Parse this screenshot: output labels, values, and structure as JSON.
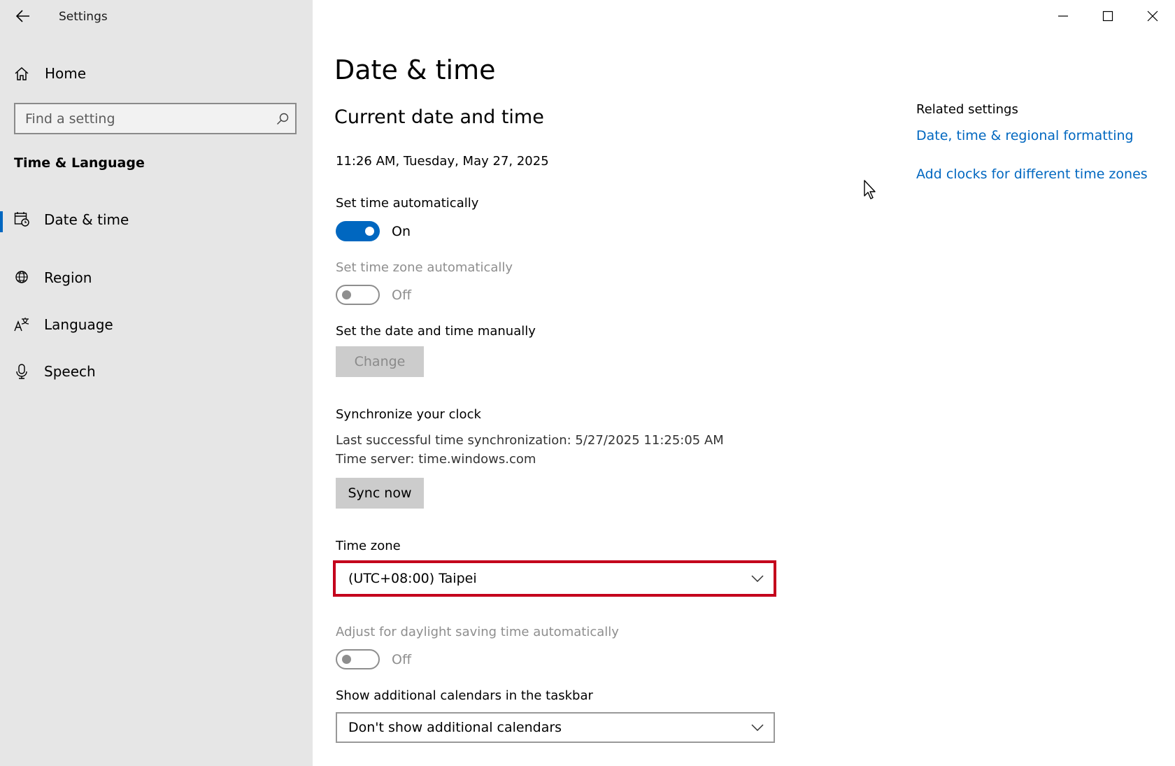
{
  "window": {
    "title": "Settings",
    "controls": [
      "minimize-icon",
      "maximize-icon",
      "close-icon"
    ]
  },
  "sidebar": {
    "home_label": "Home",
    "search_placeholder": "Find a setting",
    "section_title": "Time & Language",
    "items": [
      {
        "label": "Date & time",
        "icon": "calendar-clock-icon",
        "active": true
      },
      {
        "label": "Region",
        "icon": "globe-icon",
        "active": false
      },
      {
        "label": "Language",
        "icon": "language-icon",
        "active": false
      },
      {
        "label": "Speech",
        "icon": "microphone-icon",
        "active": false
      }
    ]
  },
  "main": {
    "title": "Date & time",
    "subtitle": "Current date and time",
    "current_datetime": "11:26 AM, Tuesday, May 27, 2025",
    "set_time_auto": {
      "label": "Set time automatically",
      "state": "On",
      "on": true
    },
    "set_tz_auto": {
      "label": "Set time zone automatically",
      "state": "Off",
      "on": false,
      "disabled": true
    },
    "manual": {
      "label": "Set the date and time manually",
      "button": "Change"
    },
    "sync": {
      "title": "Synchronize your clock",
      "last_sync": "Last successful time synchronization: 5/27/2025 11:25:05 AM",
      "server": "Time server: time.windows.com",
      "button": "Sync now"
    },
    "timezone": {
      "label": "Time zone",
      "value": "(UTC+08:00) Taipei"
    },
    "dst": {
      "label": "Adjust for daylight saving time automatically",
      "state": "Off",
      "on": false,
      "disabled": true
    },
    "calendars": {
      "label": "Show additional calendars in the taskbar",
      "value": "Don't show additional calendars"
    }
  },
  "related": {
    "header": "Related settings",
    "links": [
      "Date, time & regional formatting",
      "Add clocks for different time zones"
    ]
  },
  "colors": {
    "accent": "#0067c0",
    "sidebar_bg": "#e6e6e6",
    "highlight_border": "#c4001c"
  }
}
